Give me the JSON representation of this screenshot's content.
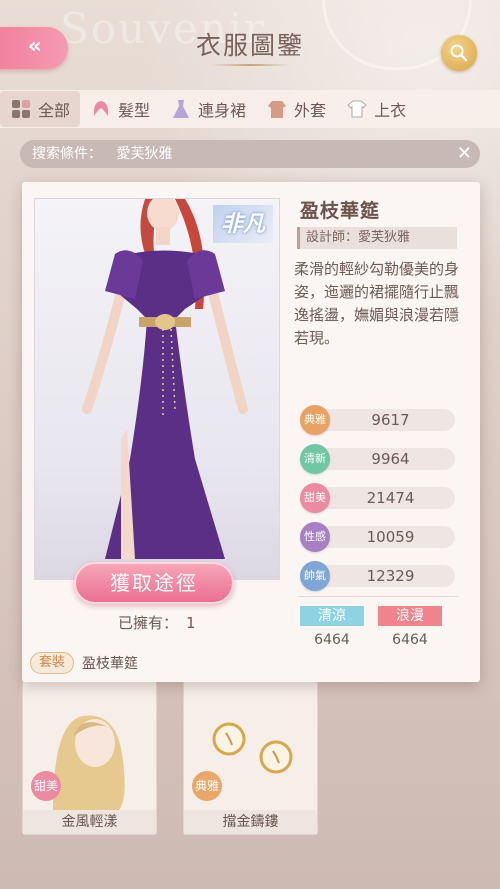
{
  "header": {
    "title": "衣服圖鑒",
    "back_icon": "«"
  },
  "tabs": [
    {
      "label": "全部",
      "icon": "grid-icon"
    },
    {
      "label": "髮型",
      "icon": "hair-icon"
    },
    {
      "label": "連身裙",
      "icon": "dress-icon"
    },
    {
      "label": "外套",
      "icon": "coat-icon"
    },
    {
      "label": "上衣",
      "icon": "shirt-icon"
    }
  ],
  "search_condition": {
    "label": "搜索條件：",
    "value": "愛芙狄雅",
    "close": "✕"
  },
  "detail": {
    "rarity": "非凡",
    "name": "盈枝華筵",
    "designer": "設計師：愛芙狄雅",
    "description": "柔滑的輕紗勾勒優美的身姿，迤邐的裙擺隨行止飄逸搖盪，嫵媚與浪漫若隱若現。",
    "acquire_button": "獲取途徑",
    "owned_label": "已擁有：",
    "owned_value": "1",
    "stats": [
      {
        "name": "典雅",
        "value": "9617",
        "color": "#e8a363"
      },
      {
        "name": "清新",
        "value": "9964",
        "color": "#6fc7a4"
      },
      {
        "name": "甜美",
        "value": "21474",
        "color": "#ec8aa1"
      },
      {
        "name": "性感",
        "value": "10059",
        "color": "#a77fc4"
      },
      {
        "name": "帥氣",
        "value": "12329",
        "color": "#7fa7d6"
      }
    ],
    "styles": [
      {
        "name": "清涼",
        "value": "6464",
        "color": "#8fd3e3"
      },
      {
        "name": "浪漫",
        "value": "6464",
        "color": "#f0848e"
      }
    ],
    "suit_tag": "套裝",
    "suit_name": "盈枝華筵"
  },
  "background_cards": [
    {
      "name": "金風輕漾",
      "badge": "甜美",
      "badge_color": "pink"
    },
    {
      "name": "擋金鑄鏤",
      "badge": "典雅",
      "badge_color": "orange"
    }
  ]
}
